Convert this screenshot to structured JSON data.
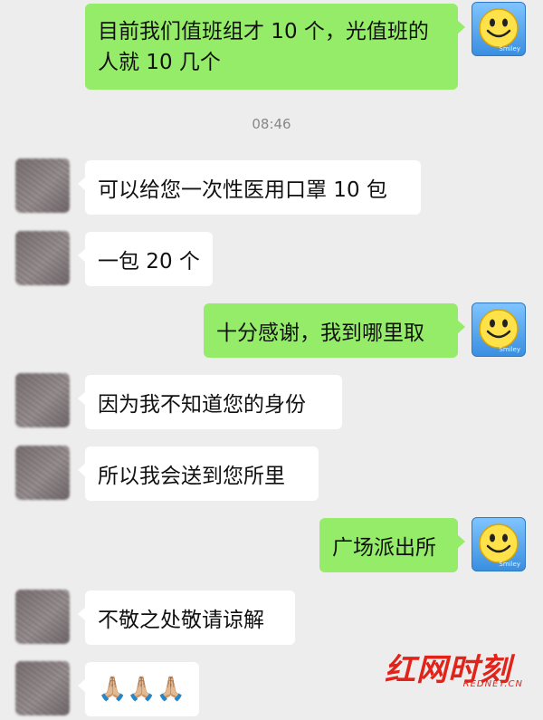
{
  "timestamp": "08:46",
  "messages": [
    {
      "side": "out",
      "text": "目前我们值班组才 10 个，光值班的人就 10 几个"
    },
    {
      "side": "in",
      "text": "可以给您一次性医用口罩 10 包"
    },
    {
      "side": "in",
      "text": "一包 20 个"
    },
    {
      "side": "out",
      "text": "十分感谢，我到哪里取"
    },
    {
      "side": "in",
      "text": "因为我不知道您的身份"
    },
    {
      "side": "in",
      "text": "所以我会送到您所里"
    },
    {
      "side": "out",
      "text": "广场派出所"
    },
    {
      "side": "in",
      "text": "不敬之处敬请谅解"
    },
    {
      "side": "in",
      "text": "🙏🏼🙏🏼🙏🏼"
    }
  ],
  "watermark": {
    "title": "红网时刻",
    "subtitle": "REDNET.CN"
  },
  "avatar_caption": "Smiley",
  "colors": {
    "outgoing_bubble": "#95ec69",
    "incoming_bubble": "#ffffff",
    "background": "#ededed",
    "brand_red": "#e2231a"
  }
}
